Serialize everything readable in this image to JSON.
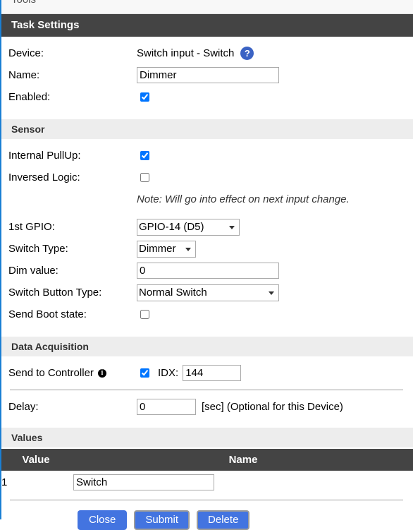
{
  "nav": {
    "tab_label": "Tools"
  },
  "task_settings": {
    "title": "Task Settings",
    "device": {
      "label": "Device:",
      "value": "Switch input - Switch",
      "help_icon": "question-mark-icon",
      "help_glyph": "?"
    },
    "name": {
      "label": "Name:",
      "value": "Dimmer",
      "placeholder": ""
    },
    "enabled": {
      "label": "Enabled:",
      "checked": true
    }
  },
  "sensor": {
    "title": "Sensor",
    "internal_pullup": {
      "label": "Internal PullUp:",
      "checked": true
    },
    "inversed_logic": {
      "label": "Inversed Logic:",
      "checked": false
    },
    "note": "Note: Will go into effect on next input change.",
    "gpio1": {
      "label": "1st GPIO:",
      "value": "GPIO-14 (D5)",
      "options": [
        "GPIO-14 (D5)"
      ]
    },
    "switch_type": {
      "label": "Switch Type:",
      "value": "Dimmer",
      "options": [
        "Dimmer"
      ]
    },
    "dim_value": {
      "label": "Dim value:",
      "value": "0",
      "placeholder": ""
    },
    "switch_button_type": {
      "label": "Switch Button Type:",
      "value": "Normal Switch",
      "options": [
        "Normal Switch"
      ]
    },
    "send_boot_state": {
      "label": "Send Boot state:",
      "checked": false
    }
  },
  "data_acquisition": {
    "title": "Data Acquisition",
    "send_to_controller": {
      "label": "Send to Controller",
      "info_icon": "info-icon",
      "info_glyph": "i",
      "checked": true
    },
    "idx": {
      "label": "IDX:",
      "value": "144",
      "placeholder": ""
    },
    "delay": {
      "label": "Delay:",
      "value": "0",
      "placeholder": "",
      "suffix": "[sec] (Optional for this Device)"
    }
  },
  "values": {
    "title": "Values",
    "columns": [
      "Value",
      "Name"
    ],
    "rows": [
      {
        "value": "1",
        "name": "Switch"
      }
    ]
  },
  "buttons": {
    "close": "Close",
    "submit": "Submit",
    "delete": "Delete"
  },
  "colors": {
    "accent_blue": "#4374e0",
    "dark_header": "#444444",
    "sub_header": "#ededed",
    "left_rule": "#1a7fd4",
    "help_blue": "#3b63c4"
  }
}
